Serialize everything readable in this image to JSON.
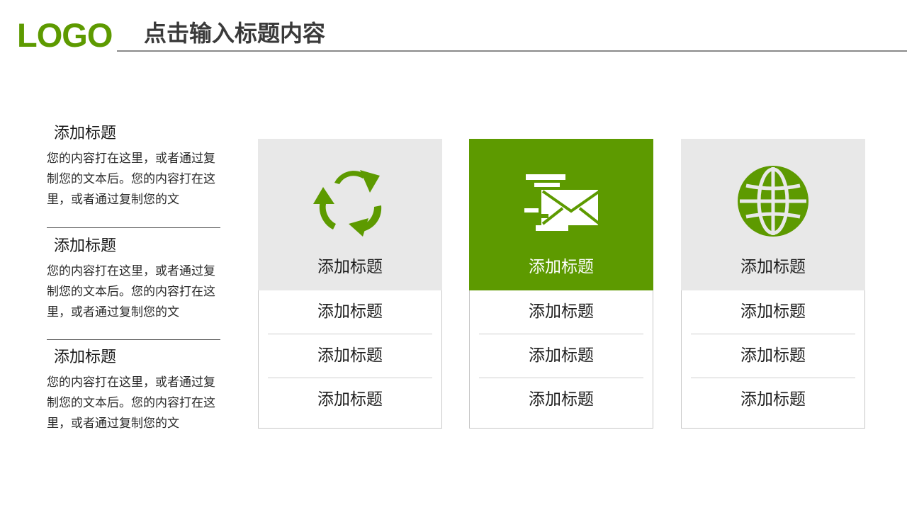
{
  "header": {
    "logo_text": "LOGO",
    "title": "点击输入标题内容"
  },
  "sidebar": {
    "sections": [
      {
        "title": "添加标题",
        "body": "您的内容打在这里，或者通过复制您的文本后。您的内容打在这里，或者通过复制您的文"
      },
      {
        "title": "添加标题",
        "body": "您的内容打在这里，或者通过复制您的文本后。您的内容打在这里，或者通过复制您的文"
      },
      {
        "title": "添加标题",
        "body": "您的内容打在这里，或者通过复制您的文本后。您的内容打在这里，或者通过复制您的文"
      }
    ]
  },
  "cards": [
    {
      "icon": "recycle-icon",
      "title": "添加标题",
      "active": false,
      "items": [
        "添加标题",
        "添加标题",
        "添加标题"
      ]
    },
    {
      "icon": "mail-icon",
      "title": "添加标题",
      "active": true,
      "items": [
        "添加标题",
        "添加标题",
        "添加标题"
      ]
    },
    {
      "icon": "globe-icon",
      "title": "添加标题",
      "active": false,
      "items": [
        "添加标题",
        "添加标题",
        "添加标题"
      ]
    }
  ],
  "colors": {
    "accent": "#5d9a00",
    "card_bg": "#e8e8e8",
    "rule": "#8a8a8a"
  }
}
